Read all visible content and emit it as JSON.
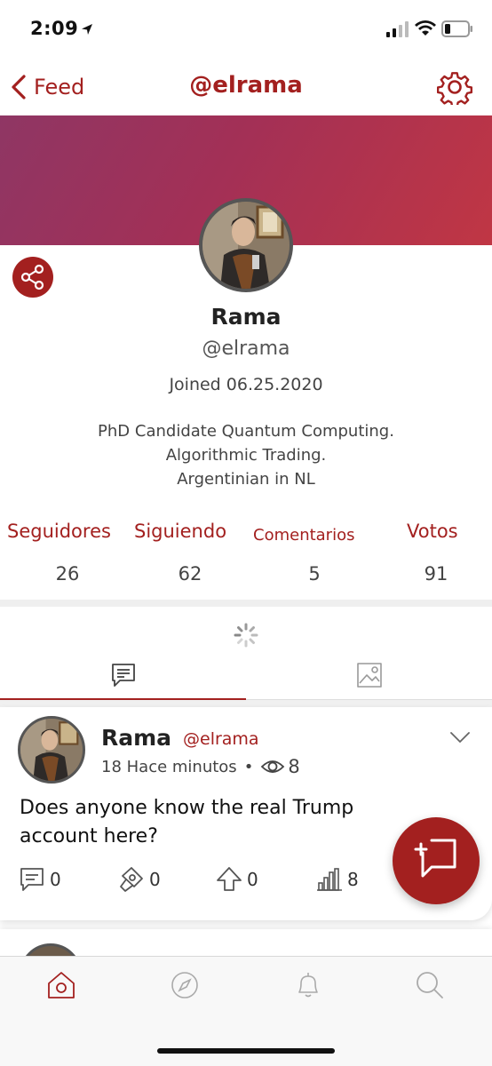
{
  "status_bar": {
    "time": "2:09"
  },
  "nav": {
    "back_label": "Feed",
    "title": "@elrama"
  },
  "profile": {
    "name": "Rama",
    "handle": "@elrama",
    "joined": "Joined 06.25.2020",
    "bio_lines": [
      "PhD Candidate Quantum Computing.",
      "Algorithmic Trading.",
      "Argentinian in NL"
    ]
  },
  "stats": [
    {
      "label": "Seguidores",
      "value": "26"
    },
    {
      "label": "Siguiendo",
      "value": "62"
    },
    {
      "label": "Comentarios",
      "value": "5"
    },
    {
      "label": "Votos",
      "value": "91"
    }
  ],
  "tabs": [
    {
      "icon": "posts-icon",
      "selected": true
    },
    {
      "icon": "image-icon",
      "selected": false
    }
  ],
  "post": {
    "author": "Rama",
    "handle": "@elrama",
    "time": "18 Hace minutos",
    "dot": "•",
    "views": "8",
    "text": "Does anyone know the real Trump account here?",
    "actions": {
      "comments": "0",
      "tips": "0",
      "upvotes": "0",
      "stats": "8"
    }
  },
  "bottom_tabs": [
    "home-icon",
    "compass-icon",
    "bell-icon",
    "search-icon"
  ],
  "colors": {
    "accent": "#a3201f",
    "banner_start": "#8f3664",
    "banner_end": "#c03644"
  }
}
